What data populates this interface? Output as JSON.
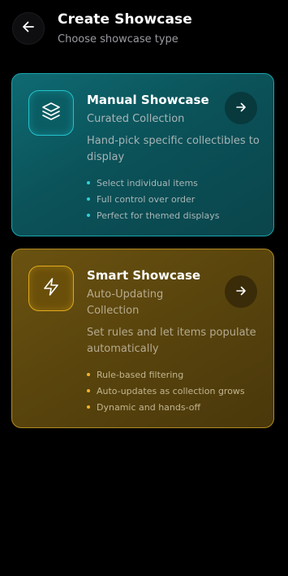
{
  "header": {
    "title": "Create Showcase",
    "subtitle": "Choose showcase type",
    "back_icon": "arrow-left-icon"
  },
  "cards": [
    {
      "id": "manual",
      "title": "Manual Showcase",
      "subtitle": "Curated Collection",
      "description": "Hand-pick specific collectibles to display",
      "icon": "layers-icon",
      "accent": "#23c2cb",
      "features": [
        "Select individual items",
        "Full control over order",
        "Perfect for themed displays"
      ]
    },
    {
      "id": "smart",
      "title": "Smart Showcase",
      "subtitle": "Auto-Updating Collection",
      "description": "Set rules and let items populate automatically",
      "icon": "lightning-icon",
      "accent": "#e0aa1c",
      "features": [
        "Rule-based filtering",
        "Auto-updates as collection grows",
        "Dynamic and hands-off"
      ]
    }
  ]
}
